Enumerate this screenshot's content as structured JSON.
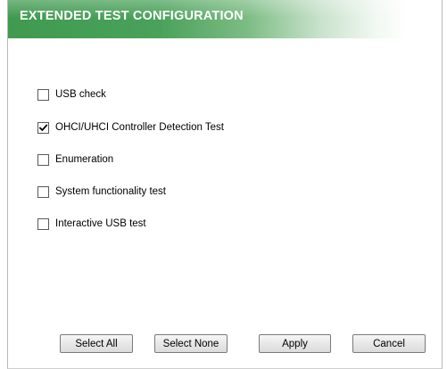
{
  "header": {
    "title": "EXTENDED TEST CONFIGURATION"
  },
  "options": [
    {
      "label": "USB check",
      "checked": false
    },
    {
      "label": "OHCI/UHCI Controller Detection Test",
      "checked": true
    },
    {
      "label": "Enumeration",
      "checked": false
    },
    {
      "label": "System functionality test",
      "checked": false
    },
    {
      "label": "Interactive USB test",
      "checked": false
    }
  ],
  "buttons": {
    "select_all": "Select All",
    "select_none": "Select None",
    "apply": "Apply",
    "cancel": "Cancel"
  }
}
